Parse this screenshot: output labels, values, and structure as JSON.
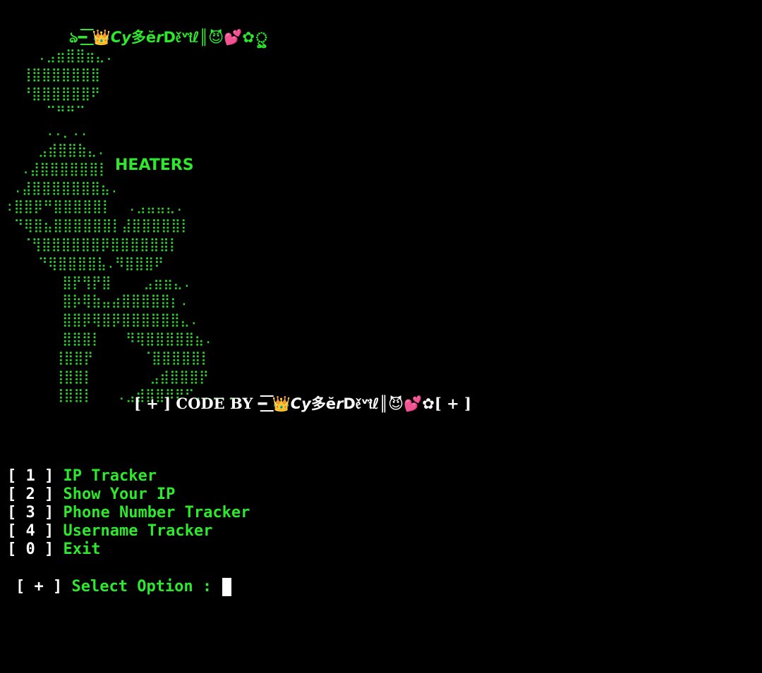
{
  "theme": {
    "background": "#000000",
    "primary_green": "#2ee82e",
    "art_green": "#2fcf2f",
    "bracket_white": "#ffffff"
  },
  "banner": {
    "title": "ঌ━͟͟͞͞ 👑𝘾𝙮多ĕ𝙧D𝔢̌ᵛ𝔦̈ℓ║😈💕✿ৣ"
  },
  "art": {
    "lines": [
      "    .⣠⣶⣿⣿⣶⣄.",
      "  ⢸⣿⣿⣿⣿⣿⣿⣿",
      "  ⠘⣿⣿⣿⣿⣿⣿⠟",
      "     ⠉⠛⠛⠉",
      "     ..⡀..",
      "    ⣠⣾⣿⣿⣷⣄.",
      "  .⣼⣿⣿⣿⣿⣿⣿⡇",
      " .⣼⣿⣿⣿⣿⣿⣿⣿⣦.",
      ":⣿⣿⡿⠛⣿⣿⣿⣿⣿⡇  .⣠⣤⣤⣄.",
      " ⠙⢿⣿⣦⣿⣿⣿⣿⣿⣿⡇⣼⣿⣿⣿⣿⣿⡇",
      "  ⠈⢻⣿⣿⣿⣿⣿⣿⡿⣿⣿⣿⣿⣿⣿⡇",
      "    ⠙⢿⣿⣿⣿⣿⣧.⠻⣿⣿⣿⠟",
      "       ⣿⡟⢻⡟⣿    ⣠⣶⣶⣄.",
      "       ⣿⡷⢿⣷⣤⣴⣿⣿⣿⣿⣿⡆.",
      "       ⣿⣿⡿⢿⣿⡿⣿⣿⣿⣿⣿⣿⣄.",
      "       ⣿⣿⣿⡇   ⠻⢿⣿⣿⣿⣿⣿⣦.",
      "      ⢸⣿⣿⡟      ⠈⣿⣿⣿⣿⣿⡇",
      "      ⢸⣿⣿⡇       ⣠⣾⣿⣿⣿⡟",
      "      ⢸⣿⣿⡇   .⣠⣾⣿⣿⡿⠟⠋......"
    ],
    "label": "HEATERS"
  },
  "credit": {
    "open_bracket": "[ + ]  ",
    "code_by": "CODE BY ",
    "author": "━͟͟͞͞ 👑𝘾𝙮多ĕ𝙧D𝔢̌ᵛ𝔦̈ℓ║😈💕✿",
    "close_bracket": "[ + ]"
  },
  "menu": {
    "items": [
      {
        "key": "[ 1 ] ",
        "label": "IP Tracker"
      },
      {
        "key": "[ 2 ] ",
        "label": "Show Your IP"
      },
      {
        "key": "[ 3 ] ",
        "label": "Phone Number Tracker"
      },
      {
        "key": "[ 4 ] ",
        "label": "Username Tracker"
      },
      {
        "key": "[ 0 ] ",
        "label": "Exit"
      }
    ]
  },
  "prompt": {
    "bracket": "[ + ] ",
    "label": "Select Option : ",
    "value": ""
  }
}
